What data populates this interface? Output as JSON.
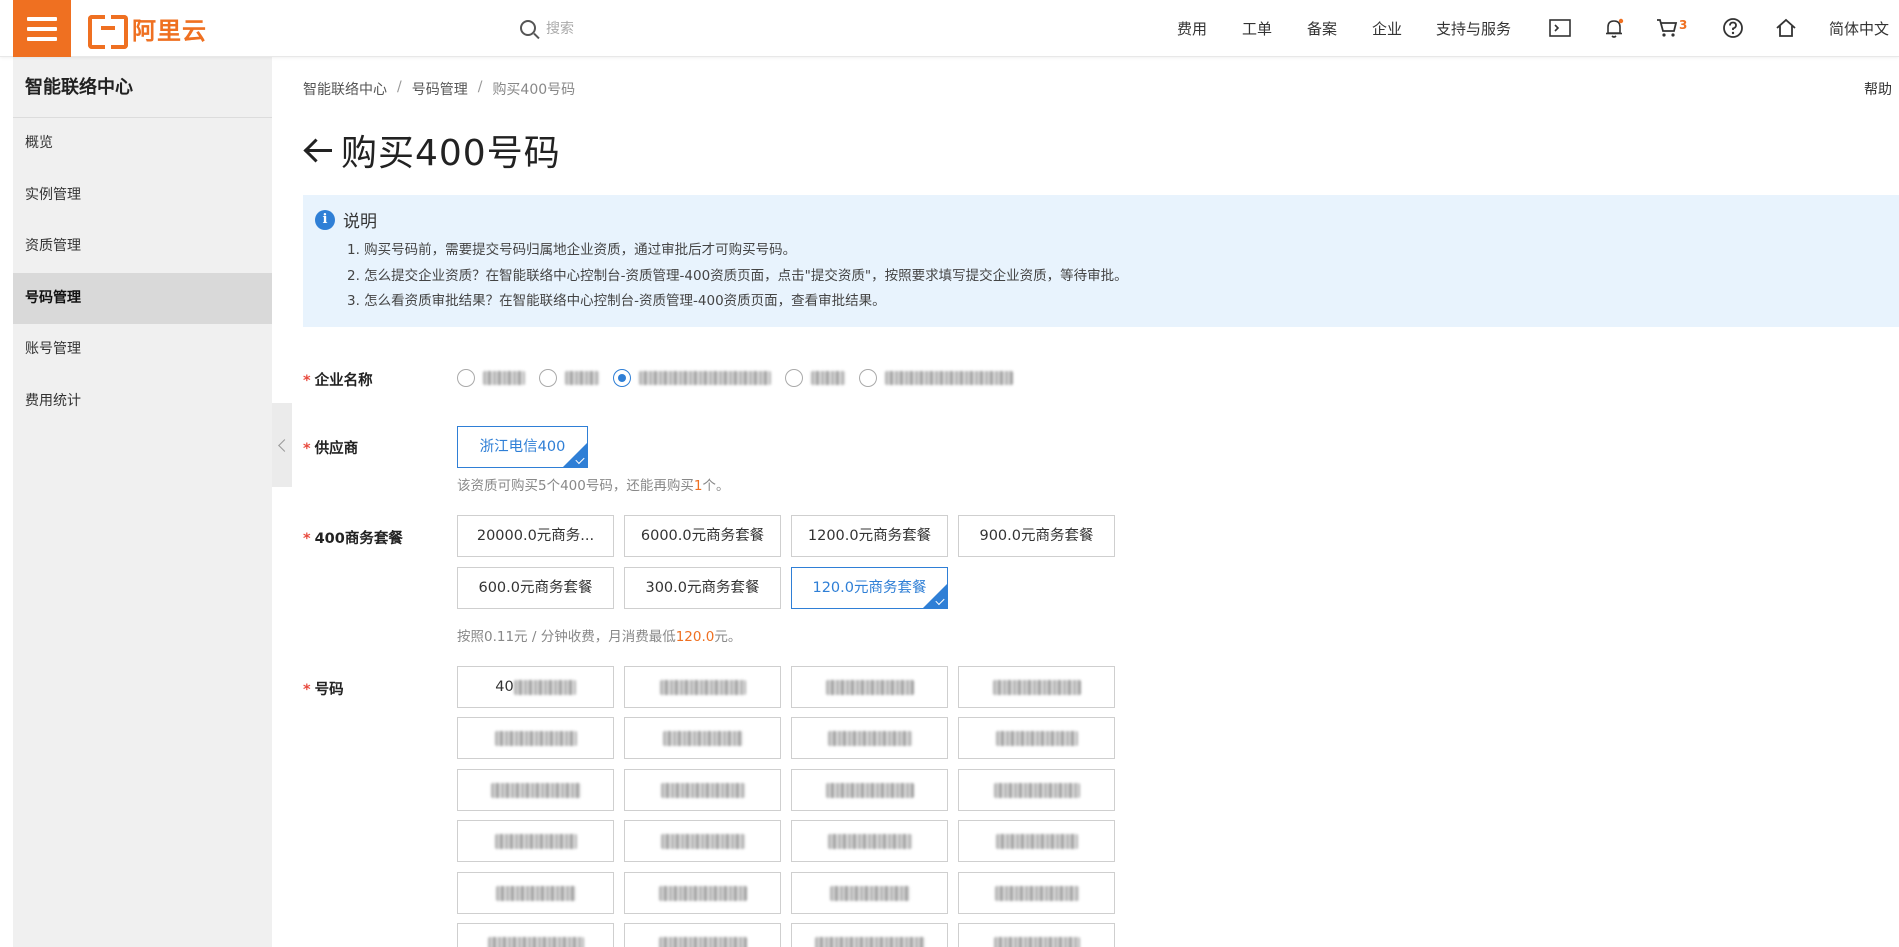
{
  "topbar": {
    "logo_text": "阿里云",
    "search_placeholder": "搜索",
    "nav": [
      "费用",
      "工单",
      "备案",
      "企业",
      "支持与服务"
    ],
    "cart_count": "3",
    "language": "简体中文"
  },
  "sidebar": {
    "title": "智能联络中心",
    "items": [
      {
        "label": "概览"
      },
      {
        "label": "实例管理"
      },
      {
        "label": "资质管理"
      },
      {
        "label": "号码管理",
        "active": true
      },
      {
        "label": "账号管理"
      },
      {
        "label": "费用统计"
      }
    ]
  },
  "breadcrumb": [
    "智能联络中心",
    "号码管理",
    "购买400号码"
  ],
  "help": "帮助",
  "page_title": "购买400号码",
  "notice": {
    "title": "说明",
    "lines": [
      "1. 购买号码前，需要提交号码归属地企业资质，通过审批后才可购买号码。",
      "2. 怎么提交企业资质？在智能联络中心控制台-资质管理-400资质页面，点击\"提交资质\"，按照要求填写提交企业资质，等待审批。",
      "3. 怎么看资质审批结果？在智能联络中心控制台-资质管理-400资质页面，查看审批结果。"
    ]
  },
  "form": {
    "company": {
      "label": "企业名称",
      "selected_index": 2,
      "option_count": 5
    },
    "supplier": {
      "label": "供应商",
      "option": "浙江电信400",
      "hint_prefix": "该资质可购买5个400号码，还能再购买",
      "hint_highlight": "1",
      "hint_suffix": "个。"
    },
    "package": {
      "label": "400商务套餐",
      "options": [
        "20000.0元商务...",
        "6000.0元商务套餐",
        "1200.0元商务套餐",
        "900.0元商务套餐",
        "600.0元商务套餐",
        "300.0元商务套餐",
        "120.0元商务套餐"
      ],
      "selected_index": 6,
      "hint_prefix": "按照0.11元 / 分钟收费，月消费最低",
      "hint_highlight": "120.0",
      "hint_suffix": "元。"
    },
    "number": {
      "label": "号码",
      "first_prefix": "40"
    }
  },
  "colors": {
    "brand": "#ef7021",
    "primary": "#2f7fd6",
    "required": "#e84a3e"
  }
}
